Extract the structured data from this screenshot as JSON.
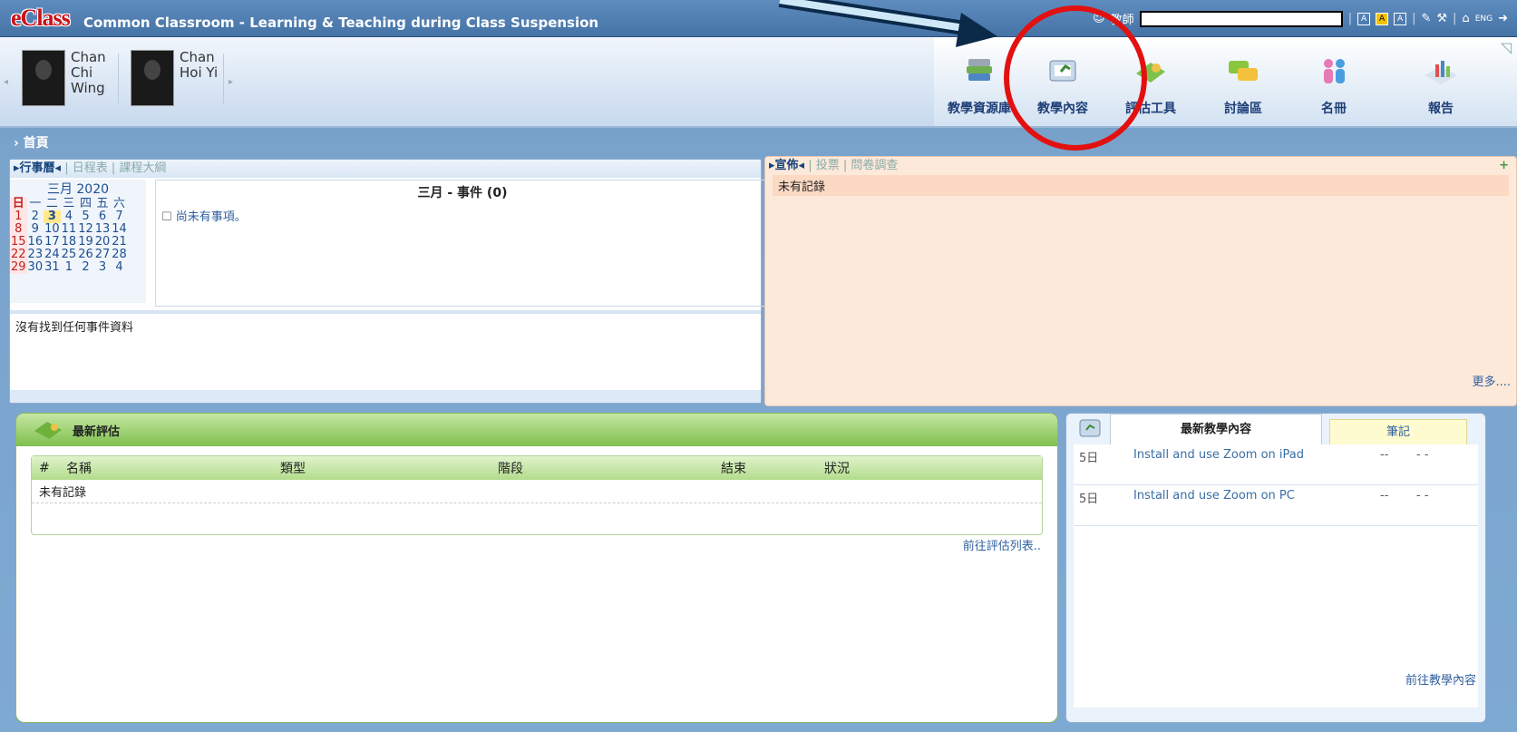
{
  "header": {
    "logo": "eClass",
    "title": "Common Classroom - Learning & Teaching during Class Suspension",
    "user_label": "教師",
    "lang": "ENG"
  },
  "students": [
    {
      "name_lines": [
        "Chan",
        "Chi",
        "Wing"
      ]
    },
    {
      "name_lines": [
        "Chan",
        "Hoi Yi"
      ]
    }
  ],
  "nav": [
    {
      "label": "教學資源庫",
      "icon": "books-icon"
    },
    {
      "label": "教學內容",
      "icon": "teaching-content-icon"
    },
    {
      "label": "評估工具",
      "icon": "assessment-icon"
    },
    {
      "label": "討論區",
      "icon": "forum-icon"
    },
    {
      "label": "名冊",
      "icon": "roster-icon"
    },
    {
      "label": "報告",
      "icon": "report-icon"
    }
  ],
  "breadcrumb": "首頁",
  "calendar_panel": {
    "tabs": [
      "行事曆",
      "日程表",
      "課程大綱"
    ],
    "month_label": "三月 2020",
    "weekdays": [
      "日",
      "一",
      "二",
      "三",
      "四",
      "五",
      "六"
    ],
    "weeks": [
      [
        "1",
        "2",
        "3",
        "4",
        "5",
        "6",
        "7"
      ],
      [
        "8",
        "9",
        "10",
        "11",
        "12",
        "13",
        "14"
      ],
      [
        "15",
        "16",
        "17",
        "18",
        "19",
        "20",
        "21"
      ],
      [
        "22",
        "23",
        "24",
        "25",
        "26",
        "27",
        "28"
      ],
      [
        "29",
        "30",
        "31",
        "1",
        "2",
        "3",
        "4"
      ]
    ],
    "events_title": "三月 - 事件 (0)",
    "no_events": "尚未有事項。",
    "no_event_data": "沒有找到任何事件資料"
  },
  "announcement_panel": {
    "tabs": [
      "宣佈",
      "投票",
      "問卷調查"
    ],
    "empty": "未有記錄",
    "more": "更多....",
    "add": "+"
  },
  "assessment_panel": {
    "title": "最新評估",
    "columns": [
      "#",
      "名稱",
      "類型",
      "階段",
      "結束",
      "狀況"
    ],
    "empty": "未有記錄",
    "link": "前往評估列表.."
  },
  "content_panel": {
    "tabs": [
      "最新教學內容",
      "筆記"
    ],
    "items": [
      {
        "day": "5日",
        "title": "Install and use Zoom on iPad",
        "c1": "--",
        "c2": "- -"
      },
      {
        "day": "5日",
        "title": "Install and use Zoom on PC",
        "c1": "--",
        "c2": "- -"
      }
    ],
    "link": "前往教學內容"
  },
  "colors": {
    "highlight_circle": "#e31010",
    "arrow_fill": "#cfe8f7",
    "arrow_outline": "#0b2a4a"
  }
}
